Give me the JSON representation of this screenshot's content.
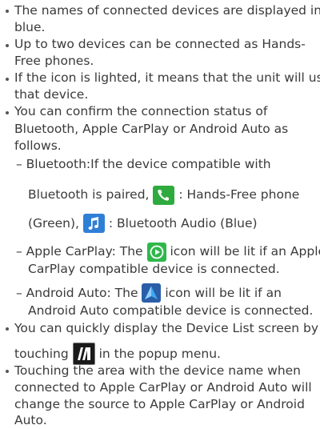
{
  "bullets": [
    {
      "lines": [
        "The names of connected devices are displayed in",
        "blue."
      ]
    },
    {
      "lines": [
        "Up to two devices can be connected as Hands-",
        "Free phones."
      ]
    },
    {
      "lines": [
        "If the icon is lighted, it means that the unit will use",
        "that device."
      ]
    },
    {
      "lines": [
        "You can confirm the connection status of",
        "Bluetooth, Apple CarPlay or Android Auto as",
        "follows."
      ]
    }
  ],
  "bluetooth": {
    "line1": "– Bluetooth:If the device compatible with",
    "line2_pre": "Bluetooth is paired,",
    "line2_post": " : Hands-Free phone",
    "line3_pre": "(Green),",
    "line3_post": " : Bluetooth Audio (Blue)"
  },
  "carplay": {
    "line1_pre": "– Apple CarPlay: The",
    "line1_post": "icon will be lit if an Apple",
    "line2": "CarPlay compatible device is connected."
  },
  "android": {
    "line1_pre": "– Android Auto: The",
    "line1_post": "icon will be lit if an",
    "line2": "Android Auto compatible device is connected."
  },
  "device_list": {
    "line1": "You can quickly display the Device List screen by",
    "line2_pre": "touching",
    "line2_post": "in the popup menu."
  },
  "last_bullet": {
    "lines": [
      "Touching the area with the device name when",
      "connected to Apple CarPlay or Android Auto will",
      "change the source to Apple CarPlay or Android",
      "Auto."
    ]
  },
  "icons": {
    "phone": "phone-icon",
    "music": "music-note-icon",
    "carplay": "carplay-play-icon",
    "android": "android-auto-arrow-icon",
    "device_list": "device-list-icon"
  },
  "colors": {
    "phone_green": "#2faa3e",
    "audio_blue": "#2f7fd6",
    "carplay_green": "#2fb84a",
    "android_blue": "#2b5ea8",
    "text": "#3a3a3a"
  }
}
